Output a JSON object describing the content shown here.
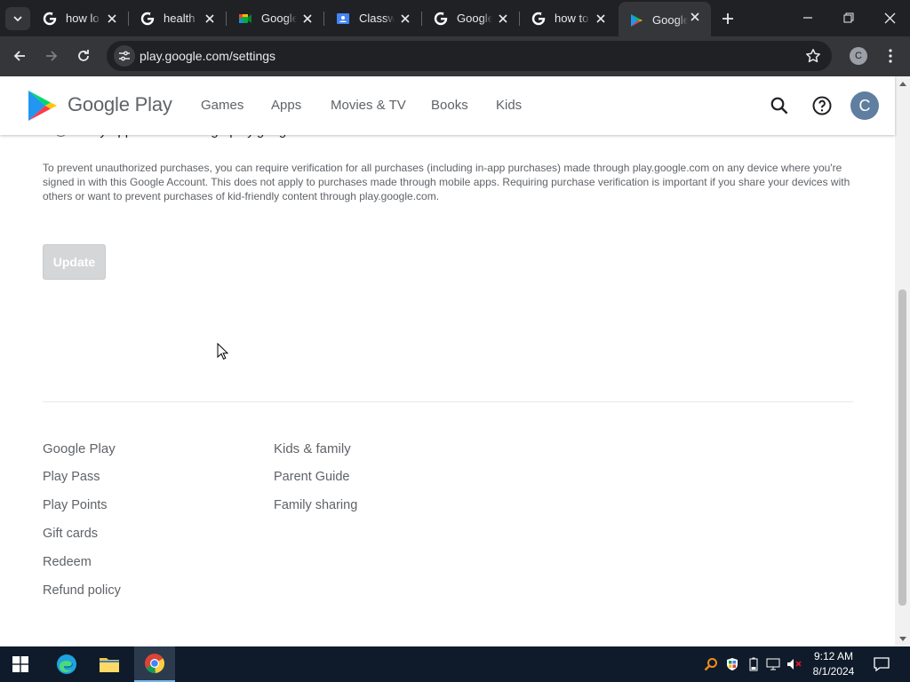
{
  "browser": {
    "tabs": [
      {
        "title": "how lo",
        "icon": "google-g-icon"
      },
      {
        "title": "health l",
        "icon": "google-g-icon"
      },
      {
        "title": "Google",
        "icon": "google-meet-icon"
      },
      {
        "title": "Classw",
        "icon": "google-classroom-icon"
      },
      {
        "title": "Google",
        "icon": "google-g-icon"
      },
      {
        "title": "how to",
        "icon": "google-g-icon"
      },
      {
        "title": "Google",
        "icon": "google-play-icon",
        "active": true
      }
    ],
    "url": "play.google.com/settings",
    "profile_initial": "C"
  },
  "header": {
    "brand": "Google Play",
    "nav": [
      "Games",
      "Apps",
      "Movies & TV",
      "Books",
      "Kids"
    ],
    "avatar_initial": "C"
  },
  "settings": {
    "radio_option": "Only app installs through play.google.com",
    "info_text": "To prevent unauthorized purchases, you can require verification for all purchases (including in-app purchases) made through play.google.com on any device where you're signed in with this Google Account. This does not apply to purchases made through mobile apps. Requiring purchase verification is important if you share your devices with others or want to prevent purchases of kid-friendly content through play.google.com.",
    "update_label": "Update"
  },
  "footer": {
    "col1": {
      "heading": "Google Play",
      "links": [
        "Play Pass",
        "Play Points",
        "Gift cards",
        "Redeem",
        "Refund policy"
      ]
    },
    "col2": {
      "heading": "Kids & family",
      "links": [
        "Parent Guide",
        "Family sharing"
      ]
    }
  },
  "taskbar": {
    "time": "9:12 AM",
    "date": "8/1/2024"
  }
}
